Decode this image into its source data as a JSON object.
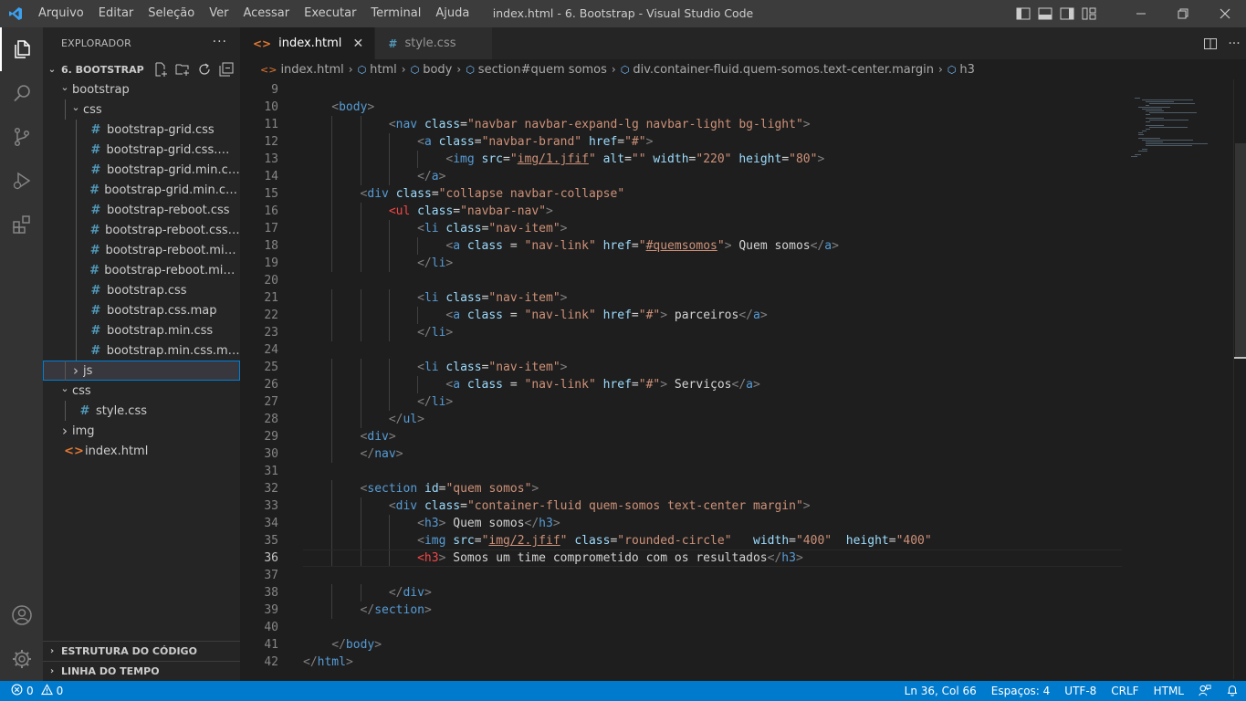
{
  "menu": {
    "items": [
      "Arquivo",
      "Editar",
      "Seleção",
      "Ver",
      "Acessar",
      "Executar",
      "Terminal",
      "Ajuda"
    ]
  },
  "window_title": "index.html - 6. Bootstrap - Visual Studio Code",
  "sidebar": {
    "header": "EXPLORADOR",
    "root": "6. BOOTSTRAP",
    "tree": [
      {
        "label": "bootstrap",
        "type": "folder-open",
        "depth": 1
      },
      {
        "label": "css",
        "type": "folder-open",
        "depth": 2
      },
      {
        "label": "bootstrap-grid.css",
        "type": "css",
        "depth": 3
      },
      {
        "label": "bootstrap-grid.css.map",
        "type": "css",
        "depth": 3
      },
      {
        "label": "bootstrap-grid.min.css",
        "type": "css",
        "depth": 3
      },
      {
        "label": "bootstrap-grid.min.css.map",
        "type": "css",
        "depth": 3
      },
      {
        "label": "bootstrap-reboot.css",
        "type": "css",
        "depth": 3
      },
      {
        "label": "bootstrap-reboot.css.map",
        "type": "css",
        "depth": 3
      },
      {
        "label": "bootstrap-reboot.min.css",
        "type": "css",
        "depth": 3
      },
      {
        "label": "bootstrap-reboot.min.css....",
        "type": "css",
        "depth": 3
      },
      {
        "label": "bootstrap.css",
        "type": "css",
        "depth": 3
      },
      {
        "label": "bootstrap.css.map",
        "type": "css",
        "depth": 3
      },
      {
        "label": "bootstrap.min.css",
        "type": "css",
        "depth": 3
      },
      {
        "label": "bootstrap.min.css.map",
        "type": "css",
        "depth": 3
      },
      {
        "label": "js",
        "type": "folder-closed",
        "depth": 2,
        "selected": true
      },
      {
        "label": "css",
        "type": "folder-open",
        "depth": 1
      },
      {
        "label": "style.css",
        "type": "css",
        "depth": 2
      },
      {
        "label": "img",
        "type": "folder-closed",
        "depth": 1
      },
      {
        "label": "index.html",
        "type": "html",
        "depth": 1
      }
    ],
    "outline": "ESTRUTURA DO CÓDIGO",
    "timeline": "LINHA DO TEMPO"
  },
  "tabs": [
    {
      "label": "index.html",
      "active": true,
      "icon": "html-icon"
    },
    {
      "label": "style.css",
      "active": false,
      "icon": "css-icon"
    }
  ],
  "breadcrumbs": [
    "index.html",
    "html",
    "body",
    "section#quem somos",
    "div.container-fluid.quem-somos.text-center.margin",
    "h3"
  ],
  "code": {
    "current_line": 36,
    "lines": [
      {
        "n": 9,
        "indent": 0,
        "tokens": []
      },
      {
        "n": 10,
        "indent": 1,
        "tokens": [
          [
            "br",
            "<"
          ],
          [
            "tag",
            "body"
          ],
          [
            "br",
            ">"
          ]
        ]
      },
      {
        "n": 11,
        "indent": 3,
        "tokens": [
          [
            "br",
            "<"
          ],
          [
            "tag",
            "nav"
          ],
          [
            "txt",
            " "
          ],
          [
            "attr",
            "class"
          ],
          [
            "txt",
            "="
          ],
          [
            "str",
            "\"navbar navbar-expand-lg navbar-light bg-light\""
          ],
          [
            "br",
            ">"
          ]
        ]
      },
      {
        "n": 12,
        "indent": 4,
        "tokens": [
          [
            "br",
            "<"
          ],
          [
            "tag",
            "a"
          ],
          [
            "txt",
            " "
          ],
          [
            "attr",
            "class"
          ],
          [
            "txt",
            "="
          ],
          [
            "str",
            "\"navbar-brand\""
          ],
          [
            "txt",
            " "
          ],
          [
            "attr",
            "href"
          ],
          [
            "txt",
            "="
          ],
          [
            "str",
            "\"#\""
          ],
          [
            "br",
            ">"
          ]
        ]
      },
      {
        "n": 13,
        "indent": 5,
        "tokens": [
          [
            "br",
            "<"
          ],
          [
            "tag",
            "img"
          ],
          [
            "txt",
            " "
          ],
          [
            "attr",
            "src"
          ],
          [
            "txt",
            "="
          ],
          [
            "str",
            "\""
          ],
          [
            "strul",
            "img/1.jfif"
          ],
          [
            "str",
            "\""
          ],
          [
            "txt",
            " "
          ],
          [
            "attr",
            "alt"
          ],
          [
            "txt",
            "="
          ],
          [
            "str",
            "\"\""
          ],
          [
            "txt",
            " "
          ],
          [
            "attr",
            "width"
          ],
          [
            "txt",
            "="
          ],
          [
            "str",
            "\"220\""
          ],
          [
            "txt",
            " "
          ],
          [
            "attr",
            "height"
          ],
          [
            "txt",
            "="
          ],
          [
            "str",
            "\"80\""
          ],
          [
            "br",
            ">"
          ]
        ]
      },
      {
        "n": 14,
        "indent": 4,
        "tokens": [
          [
            "br",
            "</"
          ],
          [
            "tag",
            "a"
          ],
          [
            "br",
            ">"
          ]
        ]
      },
      {
        "n": 15,
        "indent": 2,
        "tokens": [
          [
            "br",
            "<"
          ],
          [
            "tag",
            "div"
          ],
          [
            "txt",
            " "
          ],
          [
            "attr",
            "class"
          ],
          [
            "txt",
            "="
          ],
          [
            "str",
            "\"collapse navbar-collapse\""
          ]
        ]
      },
      {
        "n": 16,
        "indent": 3,
        "tokens": [
          [
            "err",
            "<ul"
          ],
          [
            "txt",
            " "
          ],
          [
            "attr",
            "class"
          ],
          [
            "txt",
            "="
          ],
          [
            "str",
            "\"navbar-nav\""
          ],
          [
            "br",
            ">"
          ]
        ]
      },
      {
        "n": 17,
        "indent": 4,
        "tokens": [
          [
            "br",
            "<"
          ],
          [
            "tag",
            "li"
          ],
          [
            "txt",
            " "
          ],
          [
            "attr",
            "class"
          ],
          [
            "txt",
            "="
          ],
          [
            "str",
            "\"nav-item\""
          ],
          [
            "br",
            ">"
          ]
        ]
      },
      {
        "n": 18,
        "indent": 5,
        "tokens": [
          [
            "br",
            "<"
          ],
          [
            "tag",
            "a"
          ],
          [
            "txt",
            " "
          ],
          [
            "attr",
            "class"
          ],
          [
            "txt",
            " = "
          ],
          [
            "str",
            "\"nav-link\""
          ],
          [
            "txt",
            " "
          ],
          [
            "attr",
            "href"
          ],
          [
            "txt",
            "="
          ],
          [
            "str",
            "\""
          ],
          [
            "strul",
            "#quemsomos"
          ],
          [
            "str",
            "\""
          ],
          [
            "br",
            ">"
          ],
          [
            "txt",
            " Quem somos"
          ],
          [
            "br",
            "</"
          ],
          [
            "tag",
            "a"
          ],
          [
            "br",
            ">"
          ]
        ]
      },
      {
        "n": 19,
        "indent": 4,
        "tokens": [
          [
            "br",
            "</"
          ],
          [
            "tag",
            "li"
          ],
          [
            "br",
            ">"
          ]
        ]
      },
      {
        "n": 20,
        "indent": 0,
        "tokens": []
      },
      {
        "n": 21,
        "indent": 4,
        "tokens": [
          [
            "br",
            "<"
          ],
          [
            "tag",
            "li"
          ],
          [
            "txt",
            " "
          ],
          [
            "attr",
            "class"
          ],
          [
            "txt",
            "="
          ],
          [
            "str",
            "\"nav-item\""
          ],
          [
            "br",
            ">"
          ]
        ]
      },
      {
        "n": 22,
        "indent": 5,
        "tokens": [
          [
            "br",
            "<"
          ],
          [
            "tag",
            "a"
          ],
          [
            "txt",
            " "
          ],
          [
            "attr",
            "class"
          ],
          [
            "txt",
            " = "
          ],
          [
            "str",
            "\"nav-link\""
          ],
          [
            "txt",
            " "
          ],
          [
            "attr",
            "href"
          ],
          [
            "txt",
            "="
          ],
          [
            "str",
            "\"#\""
          ],
          [
            "br",
            ">"
          ],
          [
            "txt",
            " parceiros"
          ],
          [
            "br",
            "</"
          ],
          [
            "tag",
            "a"
          ],
          [
            "br",
            ">"
          ]
        ]
      },
      {
        "n": 23,
        "indent": 4,
        "tokens": [
          [
            "br",
            "</"
          ],
          [
            "tag",
            "li"
          ],
          [
            "br",
            ">"
          ]
        ]
      },
      {
        "n": 24,
        "indent": 0,
        "tokens": []
      },
      {
        "n": 25,
        "indent": 4,
        "tokens": [
          [
            "br",
            "<"
          ],
          [
            "tag",
            "li"
          ],
          [
            "txt",
            " "
          ],
          [
            "attr",
            "class"
          ],
          [
            "txt",
            "="
          ],
          [
            "str",
            "\"nav-item\""
          ],
          [
            "br",
            ">"
          ]
        ]
      },
      {
        "n": 26,
        "indent": 5,
        "tokens": [
          [
            "br",
            "<"
          ],
          [
            "tag",
            "a"
          ],
          [
            "txt",
            " "
          ],
          [
            "attr",
            "class"
          ],
          [
            "txt",
            " = "
          ],
          [
            "str",
            "\"nav-link\""
          ],
          [
            "txt",
            " "
          ],
          [
            "attr",
            "href"
          ],
          [
            "txt",
            "="
          ],
          [
            "str",
            "\"#\""
          ],
          [
            "br",
            ">"
          ],
          [
            "txt",
            " Serviços"
          ],
          [
            "br",
            "</"
          ],
          [
            "tag",
            "a"
          ],
          [
            "br",
            ">"
          ]
        ]
      },
      {
        "n": 27,
        "indent": 4,
        "tokens": [
          [
            "br",
            "</"
          ],
          [
            "tag",
            "li"
          ],
          [
            "br",
            ">"
          ]
        ]
      },
      {
        "n": 28,
        "indent": 3,
        "tokens": [
          [
            "br",
            "</"
          ],
          [
            "tag",
            "ul"
          ],
          [
            "br",
            ">"
          ]
        ]
      },
      {
        "n": 29,
        "indent": 2,
        "tokens": [
          [
            "br",
            "<"
          ],
          [
            "tag",
            "div"
          ],
          [
            "br",
            ">"
          ]
        ]
      },
      {
        "n": 30,
        "indent": 2,
        "tokens": [
          [
            "br",
            "</"
          ],
          [
            "tag",
            "nav"
          ],
          [
            "br",
            ">"
          ]
        ]
      },
      {
        "n": 31,
        "indent": 0,
        "tokens": []
      },
      {
        "n": 32,
        "indent": 2,
        "tokens": [
          [
            "br",
            "<"
          ],
          [
            "tag",
            "section"
          ],
          [
            "txt",
            " "
          ],
          [
            "attr",
            "id"
          ],
          [
            "txt",
            "="
          ],
          [
            "str",
            "\"quem somos\""
          ],
          [
            "br",
            ">"
          ]
        ]
      },
      {
        "n": 33,
        "indent": 3,
        "tokens": [
          [
            "br",
            "<"
          ],
          [
            "tag",
            "div"
          ],
          [
            "txt",
            " "
          ],
          [
            "attr",
            "class"
          ],
          [
            "txt",
            "="
          ],
          [
            "str",
            "\"container-fluid quem-somos text-center margin\""
          ],
          [
            "br",
            ">"
          ]
        ]
      },
      {
        "n": 34,
        "indent": 4,
        "tokens": [
          [
            "br",
            "<"
          ],
          [
            "tag",
            "h3"
          ],
          [
            "br",
            ">"
          ],
          [
            "txt",
            " Quem somos"
          ],
          [
            "br",
            "</"
          ],
          [
            "tag",
            "h3"
          ],
          [
            "br",
            ">"
          ]
        ]
      },
      {
        "n": 35,
        "indent": 4,
        "tokens": [
          [
            "br",
            "<"
          ],
          [
            "tag",
            "img"
          ],
          [
            "txt",
            " "
          ],
          [
            "attr",
            "src"
          ],
          [
            "txt",
            "="
          ],
          [
            "str",
            "\""
          ],
          [
            "strul",
            "img/2.jfif"
          ],
          [
            "str",
            "\""
          ],
          [
            "txt",
            " "
          ],
          [
            "attr",
            "class"
          ],
          [
            "txt",
            "="
          ],
          [
            "str",
            "\"rounded-circle\""
          ],
          [
            "txt",
            "   "
          ],
          [
            "attr",
            "width"
          ],
          [
            "txt",
            "="
          ],
          [
            "str",
            "\"400\""
          ],
          [
            "txt",
            "  "
          ],
          [
            "attr",
            "height"
          ],
          [
            "txt",
            "="
          ],
          [
            "str",
            "\"400\""
          ]
        ]
      },
      {
        "n": 36,
        "indent": 4,
        "tokens": [
          [
            "err",
            "<h3"
          ],
          [
            "br",
            ">"
          ],
          [
            "txt",
            " Somos um time comprometido com os resultados"
          ],
          [
            "br",
            "</"
          ],
          [
            "tag",
            "h3"
          ],
          [
            "br",
            ">"
          ]
        ]
      },
      {
        "n": 37,
        "indent": 0,
        "tokens": []
      },
      {
        "n": 38,
        "indent": 3,
        "tokens": [
          [
            "br",
            "</"
          ],
          [
            "tag",
            "div"
          ],
          [
            "br",
            ">"
          ]
        ]
      },
      {
        "n": 39,
        "indent": 2,
        "tokens": [
          [
            "br",
            "</"
          ],
          [
            "tag",
            "section"
          ],
          [
            "br",
            ">"
          ]
        ]
      },
      {
        "n": 40,
        "indent": 0,
        "tokens": []
      },
      {
        "n": 41,
        "indent": 1,
        "tokens": [
          [
            "br",
            "</"
          ],
          [
            "tag",
            "body"
          ],
          [
            "br",
            ">"
          ]
        ]
      },
      {
        "n": 42,
        "indent": 0,
        "tokens": [
          [
            "br",
            "</"
          ],
          [
            "tag",
            "html"
          ],
          [
            "br",
            ">"
          ]
        ]
      }
    ]
  },
  "status": {
    "errors": "0",
    "warnings": "0",
    "position": "Ln 36, Col 66",
    "spaces": "Espaços: 4",
    "encoding": "UTF-8",
    "eol": "CRLF",
    "language": "HTML"
  },
  "colors": {
    "accent": "#007acc",
    "titlebar": "#3c3c3c",
    "sidebar": "#252526",
    "editor": "#1e1e1e"
  }
}
